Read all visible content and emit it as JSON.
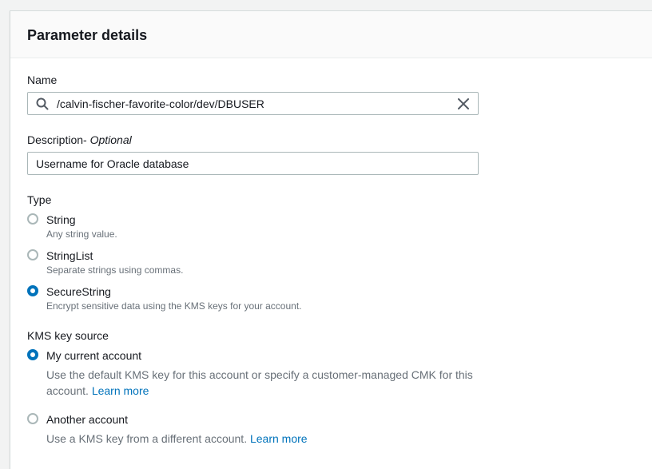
{
  "panel": {
    "title": "Parameter details"
  },
  "name_field": {
    "label": "Name",
    "value": "/calvin-fischer-favorite-color/dev/DBUSER",
    "icons": {
      "search": "search-icon",
      "clear": "close-icon"
    }
  },
  "description_field": {
    "label": "Description-",
    "optional": " Optional",
    "value": "Username for Oracle database"
  },
  "type_group": {
    "label": "Type",
    "options": [
      {
        "label": "String",
        "description": "Any string value.",
        "checked": false
      },
      {
        "label": "StringList",
        "description": "Separate strings using commas.",
        "checked": false
      },
      {
        "label": "SecureString",
        "description": "Encrypt sensitive data using the KMS keys for your account.",
        "checked": true
      }
    ]
  },
  "kms_group": {
    "label": "KMS key source",
    "options": [
      {
        "label": "My current account",
        "description": "Use the default KMS key for this account or specify a customer-managed CMK for this account.",
        "link": "Learn more",
        "checked": true
      },
      {
        "label": "Another account",
        "description": "Use a KMS key from a different account.",
        "link": "Learn more",
        "checked": false
      }
    ]
  },
  "colors": {
    "accent": "#0073bb",
    "header_bg": "#fafafa",
    "muted_text": "#687078"
  }
}
